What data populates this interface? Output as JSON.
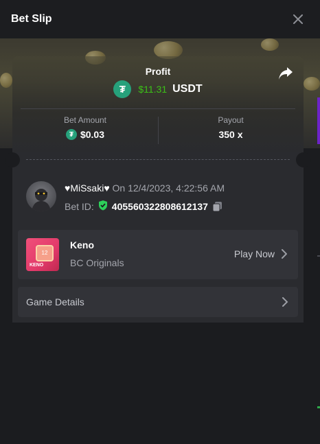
{
  "header": {
    "title": "Bet Slip"
  },
  "profit": {
    "label": "Profit",
    "amount": "$11.31",
    "currency": "USDT",
    "coin_glyph": "₮"
  },
  "bet_amount": {
    "label": "Bet Amount",
    "value": "$0.03"
  },
  "payout": {
    "label": "Payout",
    "value": "350 x"
  },
  "user": {
    "name": "♥MiSsaki♥",
    "date": "On 12/4/2023, 4:22:56 AM",
    "bet_id_label": "Bet ID:",
    "bet_id": "405560322808612137"
  },
  "game": {
    "name": "Keno",
    "provider": "BC Originals",
    "play_label": "Play Now",
    "thumb_text": "KENO",
    "thumb_number": "12"
  },
  "details": {
    "label": "Game Details"
  },
  "colors": {
    "profit_green": "#3bc117",
    "tether": "#26a17b",
    "verified_green": "#2dd05a",
    "keno_pink": "#e23a6a"
  },
  "icons": [
    "close-icon",
    "share-icon",
    "tether-icon",
    "verified-shield-icon",
    "copy-icon",
    "chevron-right-icon"
  ]
}
